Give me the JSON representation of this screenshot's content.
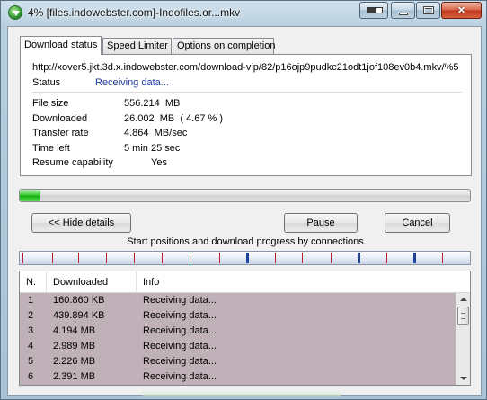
{
  "window": {
    "title": "4% [files.indowebster.com]-Indofiles.or...mkv"
  },
  "tabs": [
    {
      "label": "Download status",
      "active": true
    },
    {
      "label": "Speed Limiter",
      "active": false
    },
    {
      "label": "Options on completion",
      "active": false
    }
  ],
  "status_panel": {
    "url": "http://xover5.jkt.3d.x.indowebster.com/download-vip/82/p16ojp9pudkc21odt1jof108ev0b4.mkv/%5",
    "status_label": "Status",
    "status_value": "Receiving data...",
    "rows": [
      {
        "label": "File size",
        "value": "556.214  MB"
      },
      {
        "label": "Downloaded",
        "value": "26.002  MB  ( 4.67 % )"
      },
      {
        "label": "Transfer rate",
        "value": "4.864  MB/sec"
      },
      {
        "label": "Time left",
        "value": "5 min 25 sec"
      },
      {
        "label": "Resume capability",
        "value": "Yes"
      }
    ]
  },
  "progress_fraction": 0.0467,
  "buttons": {
    "hide_details": "<< Hide details",
    "pause": "Pause",
    "cancel": "Cancel"
  },
  "connections": {
    "caption": "Start positions and download progress by connections"
  },
  "table": {
    "columns": [
      "N.",
      "Downloaded",
      "Info"
    ],
    "rows": [
      {
        "n": "1",
        "downloaded": "160.860  KB",
        "info": "Receiving data..."
      },
      {
        "n": "2",
        "downloaded": "439.894  KB",
        "info": "Receiving data..."
      },
      {
        "n": "3",
        "downloaded": "4.194  MB",
        "info": "Receiving data..."
      },
      {
        "n": "4",
        "downloaded": "2.989  MB",
        "info": "Receiving data..."
      },
      {
        "n": "5",
        "downloaded": "2.226  MB",
        "info": "Receiving data..."
      },
      {
        "n": "6",
        "downloaded": "2.391  MB",
        "info": "Receiving data..."
      }
    ]
  },
  "colors": {
    "status_value": "#1f3c9e",
    "progress_green": "#13b10f",
    "row_background": "#c0b0b8",
    "connection_marker": "#b4242a",
    "active_connection_marker": "#1e3f9a"
  }
}
